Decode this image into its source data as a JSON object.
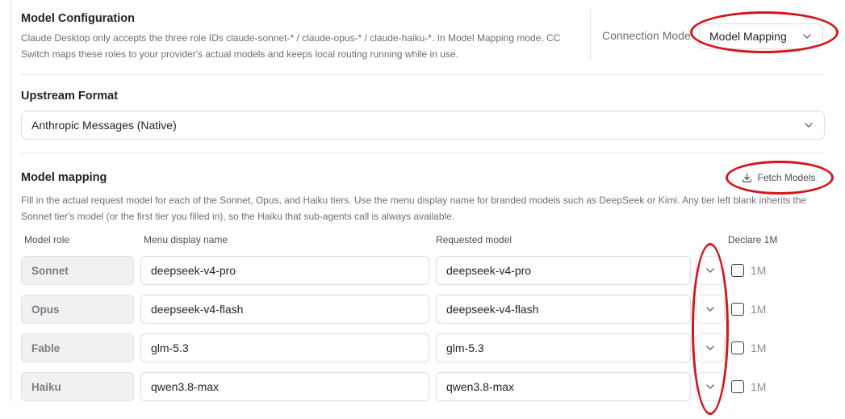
{
  "model_config": {
    "title": "Model Configuration",
    "description_line1": "Claude Desktop only accepts the three role IDs claude-sonnet-* / claude-opus-* / claude-haiku-*. In Model Mapping mode, CC",
    "description_line2": "Switch maps these roles to your provider's actual models and keeps local routing running while in use.",
    "connection_mode_label": "Connection Mode",
    "connection_mode_value": "Model Mapping"
  },
  "upstream": {
    "title": "Upstream Format",
    "value": "Anthropic Messages (Native)"
  },
  "mapping": {
    "title": "Model mapping",
    "fetch_label": "Fetch Models",
    "help_line1": "Fill in the actual request model for each of the Sonnet, Opus, and Haiku tiers. Use the menu display name for branded models such as DeepSeek or Kimi. Any tier left blank inherits the",
    "help_line2": "Sonnet tier's model (or the first tier you filled in), so the Haiku that sub-agents call is always available.",
    "headers": {
      "role": "Model role",
      "display": "Menu display name",
      "requested": "Requested model",
      "declare": "Declare 1M"
    },
    "rows": [
      {
        "role": "Sonnet",
        "display": "deepseek-v4-pro",
        "requested": "deepseek-v4-pro",
        "declare_label": "1M",
        "checked": false
      },
      {
        "role": "Opus",
        "display": "deepseek-v4-flash",
        "requested": "deepseek-v4-flash",
        "declare_label": "1M",
        "checked": false
      },
      {
        "role": "Fable",
        "display": "glm-5.3",
        "requested": "glm-5.3",
        "declare_label": "1M",
        "checked": false
      },
      {
        "role": "Haiku",
        "display": "qwen3.8-max",
        "requested": "qwen3.8-max",
        "declare_label": "1M",
        "checked": false
      }
    ]
  },
  "colors": {
    "annotation_ring": "#d6141c"
  }
}
